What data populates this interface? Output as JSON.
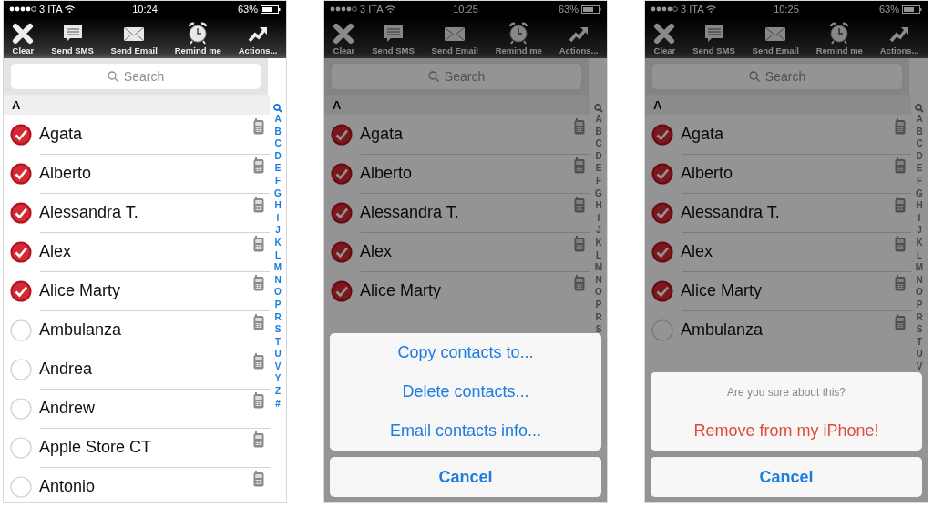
{
  "phones": [
    {
      "status": {
        "carrier": "3 ITA",
        "time": "10:24",
        "battery": "63%"
      },
      "toolbar": [
        {
          "kind": "clear",
          "label": "Clear"
        },
        {
          "kind": "sms",
          "label": "Send SMS"
        },
        {
          "kind": "email",
          "label": "Send Email"
        },
        {
          "kind": "remind",
          "label": "Remind me"
        },
        {
          "kind": "actions",
          "label": "Actions..."
        }
      ],
      "search": {
        "placeholder": "Search"
      },
      "section": "A",
      "contacts": [
        {
          "name": "Agata",
          "checked": true
        },
        {
          "name": "Alberto",
          "checked": true
        },
        {
          "name": "Alessandra T.",
          "checked": true
        },
        {
          "name": "Alex",
          "checked": true
        },
        {
          "name": "Alice Marty",
          "checked": true
        },
        {
          "name": "Ambulanza",
          "checked": false
        },
        {
          "name": "Andrea",
          "checked": false
        },
        {
          "name": "Andrew",
          "checked": false
        },
        {
          "name": "Apple Store CT",
          "checked": false
        },
        {
          "name": "Antonio",
          "checked": false
        }
      ],
      "index": [
        "A",
        "B",
        "C",
        "D",
        "E",
        "F",
        "G",
        "H",
        "I",
        "J",
        "K",
        "L",
        "M",
        "N",
        "O",
        "P",
        "R",
        "S",
        "T",
        "U",
        "V",
        "Y",
        "Z",
        "#"
      ]
    },
    {
      "status": {
        "carrier": "3 ITA",
        "time": "10:25",
        "battery": "63%"
      },
      "toolbar": [
        {
          "kind": "clear",
          "label": "Clear"
        },
        {
          "kind": "sms",
          "label": "Send SMS"
        },
        {
          "kind": "email",
          "label": "Send Email"
        },
        {
          "kind": "remind",
          "label": "Remind me"
        },
        {
          "kind": "actions",
          "label": "Actions..."
        }
      ],
      "search": {
        "placeholder": "Search"
      },
      "section": "A",
      "contacts": [
        {
          "name": "Agata",
          "checked": true
        },
        {
          "name": "Alberto",
          "checked": true
        },
        {
          "name": "Alessandra T.",
          "checked": true
        },
        {
          "name": "Alex",
          "checked": true
        },
        {
          "name": "Alice Marty",
          "checked": true
        }
      ],
      "index": [
        "A",
        "B",
        "C",
        "D",
        "E",
        "F",
        "G",
        "H",
        "I",
        "J",
        "K",
        "L",
        "M",
        "N",
        "O",
        "P",
        "R",
        "S"
      ],
      "dimmed": true,
      "sheet": {
        "kind": "actions",
        "items": [
          {
            "label": "Copy contacts to...",
            "destructive": false
          },
          {
            "label": "Delete contacts...",
            "destructive": false
          },
          {
            "label": "Email contacts info...",
            "destructive": false
          }
        ],
        "cancel": "Cancel"
      }
    },
    {
      "status": {
        "carrier": "3 ITA",
        "time": "10:25",
        "battery": "63%"
      },
      "toolbar": [
        {
          "kind": "clear",
          "label": "Clear"
        },
        {
          "kind": "sms",
          "label": "Send SMS"
        },
        {
          "kind": "email",
          "label": "Send Email"
        },
        {
          "kind": "remind",
          "label": "Remind me"
        },
        {
          "kind": "actions",
          "label": "Actions..."
        }
      ],
      "search": {
        "placeholder": "Search"
      },
      "section": "A",
      "contacts": [
        {
          "name": "Agata",
          "checked": true
        },
        {
          "name": "Alberto",
          "checked": true
        },
        {
          "name": "Alessandra T.",
          "checked": true
        },
        {
          "name": "Alex",
          "checked": true
        },
        {
          "name": "Alice Marty",
          "checked": true
        },
        {
          "name": "Ambulanza",
          "checked": false
        }
      ],
      "index": [
        "A",
        "B",
        "C",
        "D",
        "E",
        "F",
        "G",
        "H",
        "I",
        "J",
        "K",
        "L",
        "M",
        "N",
        "O",
        "P",
        "R",
        "S",
        "T",
        "U",
        "V"
      ],
      "dimmed": true,
      "sheet": {
        "kind": "confirm",
        "message": "Are you sure about this?",
        "items": [
          {
            "label": "Remove from my iPhone!",
            "destructive": true
          }
        ],
        "cancel": "Cancel"
      }
    }
  ]
}
